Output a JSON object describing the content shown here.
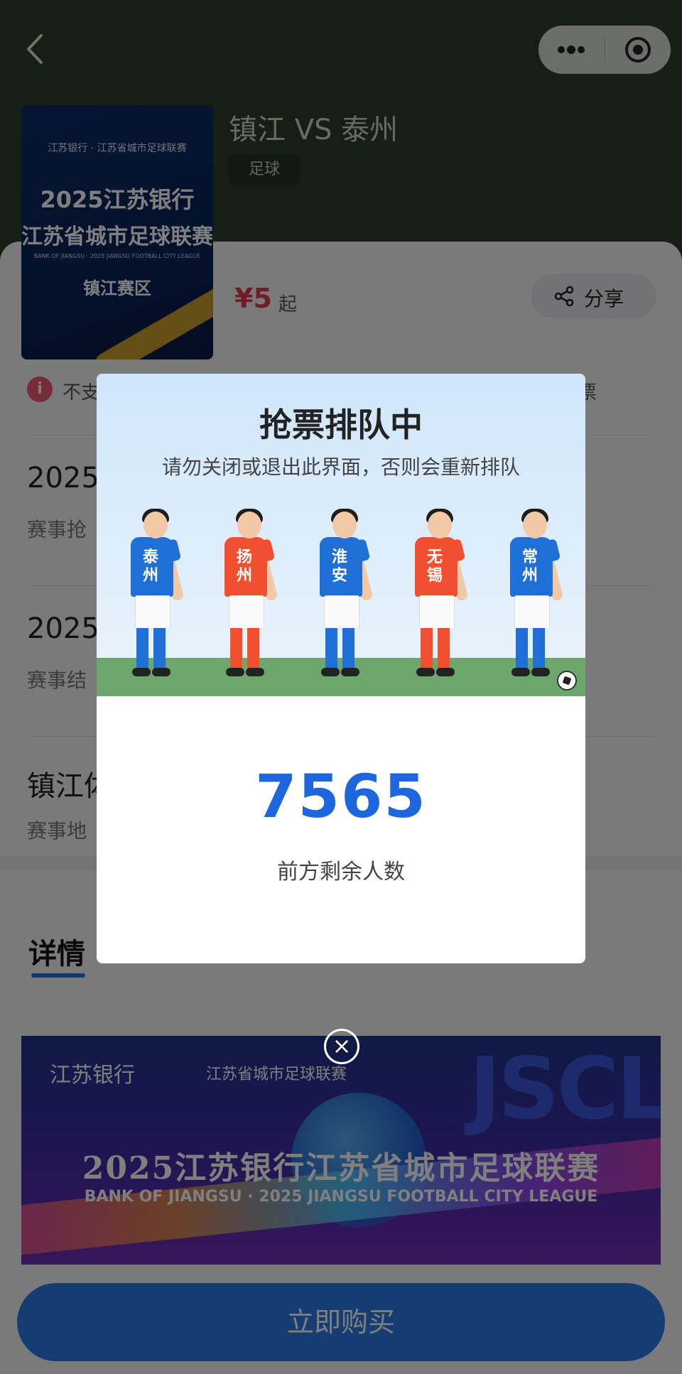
{
  "header": {
    "match_title": "镇江 VS 泰州",
    "sport_tag": "足球"
  },
  "poster": {
    "sponsor": "江苏银行 · 江苏省城市足球联赛",
    "line1": "2025江苏银行",
    "line2": "江苏省城市足球联赛",
    "line3": "BANK OF JIANGSU · 2025 JIANGSU FOOTBALL CITY LEAGUE",
    "line4": "镇江赛区"
  },
  "pricing": {
    "price": "¥5",
    "suffix": "起",
    "share_label": "分享"
  },
  "notice": {
    "icon": "i",
    "text": "不支",
    "tail": "票"
  },
  "info_rows": [
    {
      "title": "2025",
      "sub": "赛事抢"
    },
    {
      "title": "2025",
      "sub": "赛事结"
    },
    {
      "title": "镇江体",
      "sub": "赛事地"
    }
  ],
  "details": {
    "label": "详情"
  },
  "banner": {
    "logo1": "江苏银行",
    "logo2": "江苏省城市足球联赛",
    "bg_text": "JSCL",
    "title": "2025江苏银行江苏省城市足球联赛",
    "subtitle": "BANK OF JIANGSU · 2025 JIANGSU FOOTBALL CITY LEAGUE"
  },
  "buy_button": "立即购买",
  "modal": {
    "title": "抢票排队中",
    "subtitle": "请勿关闭或退出此界面，否则会重新排队",
    "count": "7565",
    "count_label": "前方剩余人数",
    "players": [
      {
        "name": "泰州",
        "color": "#1f6fd6",
        "sock": "#1f6fd6"
      },
      {
        "name": "扬州",
        "color": "#f0502f",
        "sock": "#f0502f"
      },
      {
        "name": "淮安",
        "color": "#1f6fd6",
        "sock": "#1f6fd6"
      },
      {
        "name": "无锡",
        "color": "#f0502f",
        "sock": "#f0502f"
      },
      {
        "name": "常州",
        "color": "#1f6fd6",
        "sock": "#1f6fd6"
      }
    ]
  },
  "close_icon": "×",
  "colors": {
    "accent": "#1e66dd",
    "price": "#e03b4e",
    "buy": "#2a7be6"
  }
}
